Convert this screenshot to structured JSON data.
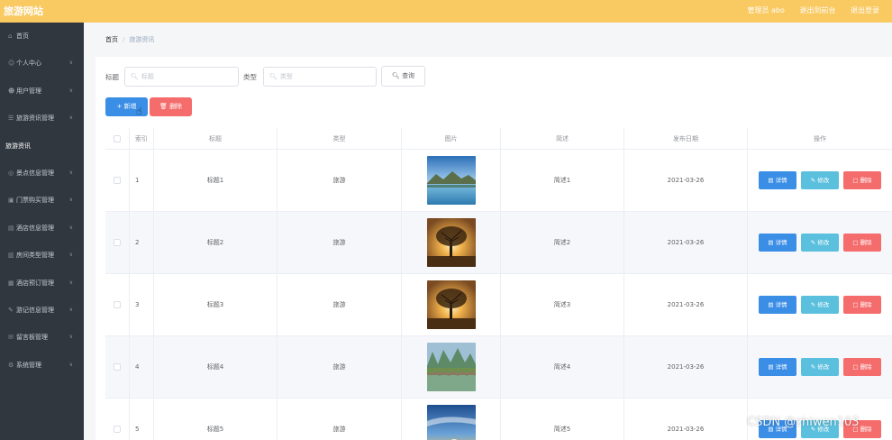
{
  "app": {
    "title": "旅游网站"
  },
  "topbar": {
    "links": [
      "管理员 abo",
      "退出到前台",
      "退出登录"
    ]
  },
  "sidebar": {
    "items": [
      {
        "label": "首页",
        "icon": "home-icon",
        "chevron": false
      },
      {
        "label": "个人中心",
        "icon": "user-icon",
        "chevron": true
      },
      {
        "label": "用户管理",
        "icon": "users-icon",
        "chevron": true
      },
      {
        "label": "旅游资讯管理",
        "icon": "news-icon",
        "chevron": true
      },
      {
        "label": "旅游资讯",
        "icon": "",
        "chevron": false,
        "sub": true
      },
      {
        "label": "景点信息管理",
        "icon": "location-icon",
        "chevron": true
      },
      {
        "label": "门票购买管理",
        "icon": "ticket-icon",
        "chevron": true
      },
      {
        "label": "酒店信息管理",
        "icon": "hotel-icon",
        "chevron": true
      },
      {
        "label": "房间类型管理",
        "icon": "room-icon",
        "chevron": true
      },
      {
        "label": "酒店预订管理",
        "icon": "booking-icon",
        "chevron": true
      },
      {
        "label": "游记信息管理",
        "icon": "notes-icon",
        "chevron": true
      },
      {
        "label": "留言板管理",
        "icon": "message-icon",
        "chevron": true
      },
      {
        "label": "系统管理",
        "icon": "settings-icon",
        "chevron": true
      }
    ]
  },
  "breadcrumb": {
    "home": "首页",
    "separator": "/",
    "current": "旅游资讯"
  },
  "search": {
    "title_label": "标题",
    "title_placeholder": "标题",
    "type_label": "类型",
    "type_placeholder": "类型",
    "query_button": "查询"
  },
  "actions": {
    "add_button": "新增",
    "delete_button": "删除"
  },
  "table": {
    "headers": {
      "index": "索引",
      "title": "标题",
      "type": "类型",
      "picture": "图片",
      "description": "简述",
      "date": "发布日期",
      "operations": "操作"
    },
    "buttons": {
      "detail": "详情",
      "edit": "修改",
      "remove": "删除"
    },
    "rows": [
      {
        "index": "1",
        "title": "标题1",
        "type": "旅游",
        "picture": "lake-landscape",
        "description": "简述1",
        "date": "2021-03-26"
      },
      {
        "index": "2",
        "title": "标题2",
        "type": "旅游",
        "picture": "tree-sunset",
        "description": "简述2",
        "date": "2021-03-26"
      },
      {
        "index": "3",
        "title": "标题3",
        "type": "旅游",
        "picture": "tree-sunset",
        "description": "简述3",
        "date": "2021-03-26"
      },
      {
        "index": "4",
        "title": "标题4",
        "type": "旅游",
        "picture": "bridge-karst",
        "description": "简述4",
        "date": "2021-03-26"
      },
      {
        "index": "5",
        "title": "标题5",
        "type": "旅游",
        "picture": "sky-sunset",
        "description": "简述5",
        "date": "2021-03-26"
      }
    ]
  },
  "watermark": "CSDN @zhiwen103",
  "colors": {
    "topbar": "#f9c962",
    "sidebar": "#30373f",
    "primary": "#3a8ee6",
    "info": "#5bc0de",
    "danger": "#f56c6c"
  }
}
